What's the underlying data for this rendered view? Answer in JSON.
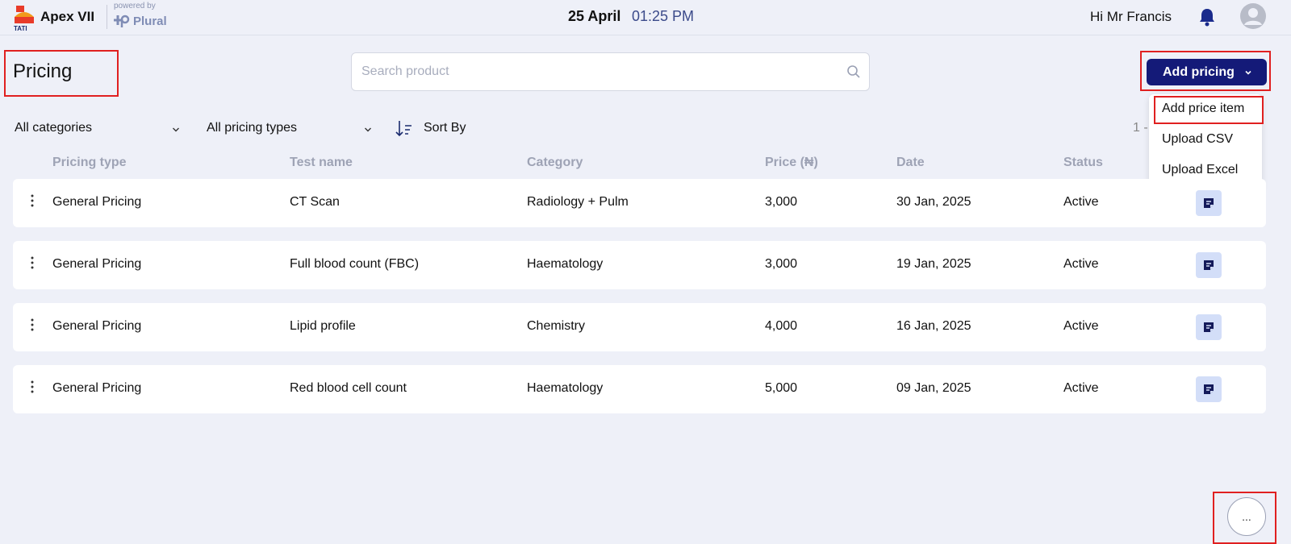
{
  "header": {
    "app_name": "Apex VII",
    "powered_by": "powered by",
    "brand": "Plural",
    "date": "25 April",
    "time": "01:25 PM",
    "greeting": "Hi Mr Francis",
    "logo_text": "TATI",
    "icons": [
      "bell-icon",
      "user-avatar-icon"
    ]
  },
  "page": {
    "title": "Pricing",
    "search_placeholder": "Search product",
    "add_button": "Add pricing",
    "add_menu": [
      "Add price item",
      "Upload CSV",
      "Upload Excel"
    ]
  },
  "filters": {
    "category": "All categories",
    "pricing_type": "All pricing types",
    "sort": "Sort By",
    "pagination": "1 -"
  },
  "table": {
    "headers": [
      "Pricing type",
      "Test name",
      "Category",
      "Price (₦)",
      "Date",
      "Status"
    ],
    "rows": [
      {
        "type": "General Pricing",
        "test": "CT Scan",
        "category": "Radiology + Pulm",
        "price": "3,000",
        "date": "30 Jan, 2025",
        "status": "Active"
      },
      {
        "type": "General Pricing",
        "test": "Full blood count (FBC)",
        "category": "Haematology",
        "price": "3,000",
        "date": "19 Jan, 2025",
        "status": "Active"
      },
      {
        "type": "General Pricing",
        "test": "Lipid profile",
        "category": "Chemistry",
        "price": "4,000",
        "date": "16 Jan, 2025",
        "status": "Active"
      },
      {
        "type": "General Pricing",
        "test": "Red blood cell count",
        "category": "Haematology",
        "price": "5,000",
        "date": "09 Jan, 2025",
        "status": "Active"
      }
    ]
  },
  "fab_label": "...",
  "colors": {
    "primary": "#141a78",
    "background": "#eef0f8",
    "highlight": "#e02020",
    "edit_bg": "#d3def8"
  }
}
